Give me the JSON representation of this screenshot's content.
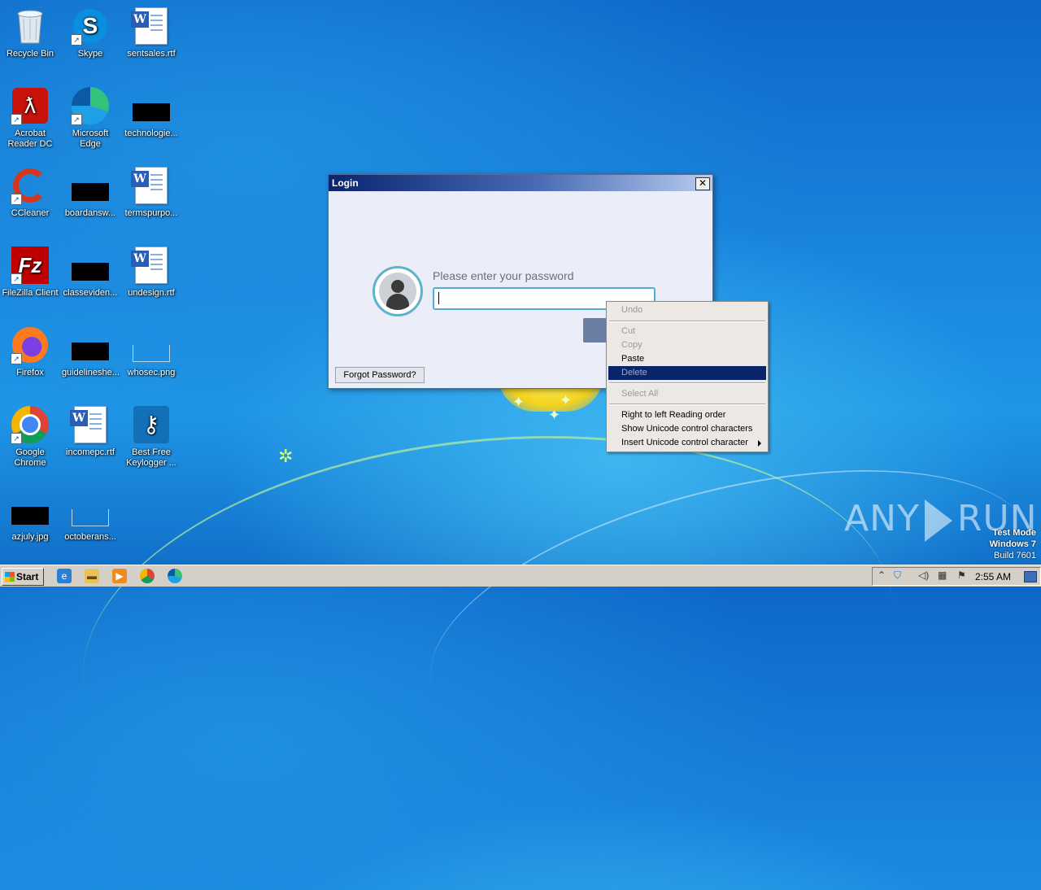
{
  "desktop": {
    "icons": [
      {
        "label": "Recycle Bin",
        "icon": "recycle-bin-icon"
      },
      {
        "label": "Skype",
        "icon": "skype-icon"
      },
      {
        "label": "sentsales.rtf",
        "icon": "word-doc-icon"
      },
      {
        "label": "Acrobat Reader DC",
        "icon": "acrobat-icon"
      },
      {
        "label": "Microsoft Edge",
        "icon": "edge-icon"
      },
      {
        "label": "technologie...",
        "icon": "black-thumbnail-icon"
      },
      {
        "label": "CCleaner",
        "icon": "ccleaner-icon"
      },
      {
        "label": "boardansw...",
        "icon": "black-thumbnail-icon"
      },
      {
        "label": "termspurpo...",
        "icon": "word-doc-icon"
      },
      {
        "label": "FileZilla Client",
        "icon": "filezilla-icon"
      },
      {
        "label": "classeviden...",
        "icon": "black-thumbnail-icon"
      },
      {
        "label": "undesign.rtf",
        "icon": "word-doc-icon"
      },
      {
        "label": "Firefox",
        "icon": "firefox-icon"
      },
      {
        "label": "guidelineshe...",
        "icon": "black-thumbnail-icon"
      },
      {
        "label": "whosec.png",
        "icon": "image-thumbnail-icon"
      },
      {
        "label": "Google Chrome",
        "icon": "chrome-icon"
      },
      {
        "label": "incomepc.rtf",
        "icon": "word-doc-icon"
      },
      {
        "label": "Best Free Keylogger ...",
        "icon": "keylogger-icon"
      },
      {
        "label": "azjuly.jpg",
        "icon": "black-thumbnail-icon"
      },
      {
        "label": "octoberans...",
        "icon": "image-thumbnail-icon"
      }
    ]
  },
  "dialog": {
    "title": "Login",
    "close_glyph": "✕",
    "prompt": "Please enter your password",
    "password_value": "",
    "forgot_label": "Forgot Password?"
  },
  "context_menu": {
    "items": [
      {
        "label": "Undo",
        "enabled": false
      },
      {
        "label": "Cut",
        "enabled": false
      },
      {
        "label": "Copy",
        "enabled": false
      },
      {
        "label": "Paste",
        "enabled": true
      },
      {
        "label": "Delete",
        "enabled": false,
        "highlighted": true
      },
      {
        "label": "Select All",
        "enabled": false
      },
      {
        "label": "Right to left Reading order",
        "enabled": true
      },
      {
        "label": "Show Unicode control characters",
        "enabled": true
      },
      {
        "label": "Insert Unicode control character",
        "enabled": true,
        "submenu": true
      }
    ]
  },
  "watermark": {
    "brand_left": "ANY",
    "brand_right": "RUN",
    "test_mode": "Test Mode",
    "os": "Windows 7",
    "build": "Build 7601"
  },
  "taskbar": {
    "start_label": "Start",
    "pinned": [
      "internet-explorer-icon",
      "file-explorer-icon",
      "media-player-icon",
      "chrome-icon",
      "edge-icon"
    ],
    "clock": "2:55 AM"
  },
  "colors": {
    "titlebar_start": "#0a246a",
    "menu_highlight": "#0a246a",
    "field_border": "#4fb0cf",
    "desktop_blue": "#1a86de"
  }
}
